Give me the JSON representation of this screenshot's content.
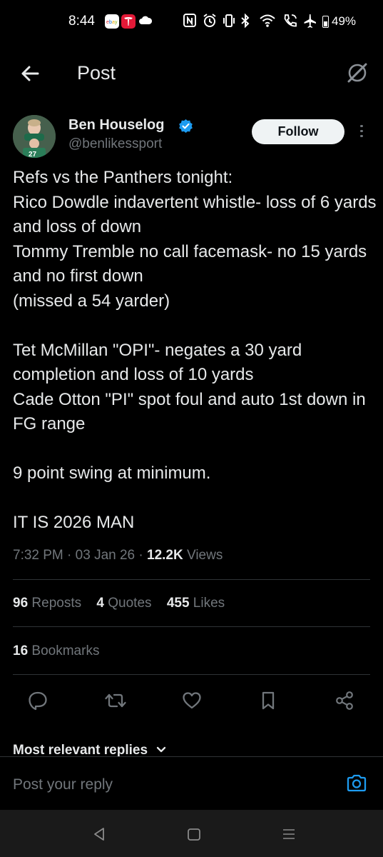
{
  "status_bar": {
    "time": "8:44",
    "battery": "49%"
  },
  "header": {
    "title": "Post"
  },
  "author": {
    "name": "Ben Houselog",
    "handle": "@benlikessport",
    "follow_label": "Follow"
  },
  "post": {
    "text": "Refs vs the Panthers tonight:\nRico Dowdle indavertent whistle- loss of 6 yards and loss of down\nTommy Tremble no call facemask- no 15 yards and no first down\n(missed a 54 yarder)\n\nTet McMillan \"OPI\"- negates a 30 yard completion and loss of 10 yards\nCade Otton \"PI\" spot foul and auto 1st down in FG range\n\n9 point swing at minimum.\n\nIT IS 2026 MAN",
    "time": "7:32 PM",
    "date": "03 Jan 26",
    "views_count": "12.2K",
    "views_label": "Views"
  },
  "stats": {
    "reposts_count": "96",
    "reposts_label": "Reposts",
    "quotes_count": "4",
    "quotes_label": "Quotes",
    "likes_count": "455",
    "likes_label": "Likes",
    "bookmarks_count": "16",
    "bookmarks_label": "Bookmarks"
  },
  "replies": {
    "sort_label": "Most relevant replies"
  },
  "composer": {
    "placeholder": "Post your reply"
  },
  "colors": {
    "background": "#000000",
    "text": "#e7e9ea",
    "muted": "#71767b",
    "accent": "#1d9bf0",
    "divider": "#2f3336"
  }
}
